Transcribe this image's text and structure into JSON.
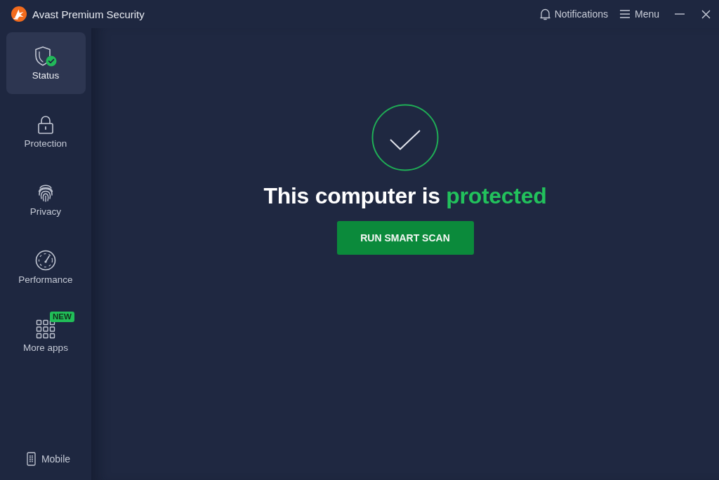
{
  "window": {
    "title": "Avast Premium Security"
  },
  "header": {
    "actions": [
      {
        "kind": "notifications",
        "label": "Notifications"
      },
      {
        "kind": "menu",
        "label": "Menu"
      }
    ]
  },
  "sidebar": {
    "items": [
      {
        "kind": "status",
        "label": "Status",
        "selected": true
      },
      {
        "kind": "protection",
        "label": "Protection",
        "selected": false
      },
      {
        "kind": "privacy",
        "label": "Privacy",
        "selected": false
      },
      {
        "kind": "performance",
        "label": "Performance",
        "selected": false
      },
      {
        "kind": "apps",
        "label": "More apps",
        "selected": false,
        "badge": "NEW"
      }
    ],
    "footer": {
      "label": "Mobile"
    }
  },
  "status": {
    "headline": "This computer is **protected**",
    "button": "RUN SMART SCAN"
  }
}
